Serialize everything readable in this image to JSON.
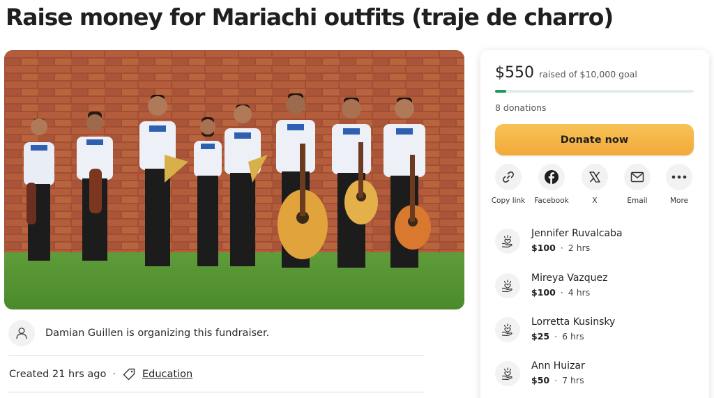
{
  "page": {
    "title": "Raise money for Mariachi outfits (traje de charro)"
  },
  "organizer": {
    "text": "Damian Guillen is organizing this fundraiser.",
    "created": "Created 21 hrs ago",
    "separator": "·",
    "category": "Education"
  },
  "donation": {
    "amount": "$550",
    "goal_text": "raised of $10,000 goal",
    "progress_fraction": 0.055,
    "count": "8 donations",
    "donate_label": "Donate now"
  },
  "share": [
    {
      "label": "Copy link",
      "icon": "link-icon"
    },
    {
      "label": "Facebook",
      "icon": "facebook-icon"
    },
    {
      "label": "X",
      "icon": "x-icon"
    },
    {
      "label": "Email",
      "icon": "email-icon"
    },
    {
      "label": "More",
      "icon": "more-icon"
    }
  ],
  "donors": [
    {
      "name": "Jennifer Ruvalcaba",
      "amount": "$100",
      "time": "2 hrs"
    },
    {
      "name": "Mireya Vazquez",
      "amount": "$100",
      "time": "4 hrs"
    },
    {
      "name": "Lorretta Kusinsky",
      "amount": "$25",
      "time": "6 hrs"
    },
    {
      "name": "Ann Huizar",
      "amount": "$50",
      "time": "7 hrs"
    }
  ],
  "donor_separator": "·",
  "colors": {
    "progress": "#1b9c5b",
    "donate_button": "#f5b548",
    "icon_bg": "#f2f2f2"
  }
}
